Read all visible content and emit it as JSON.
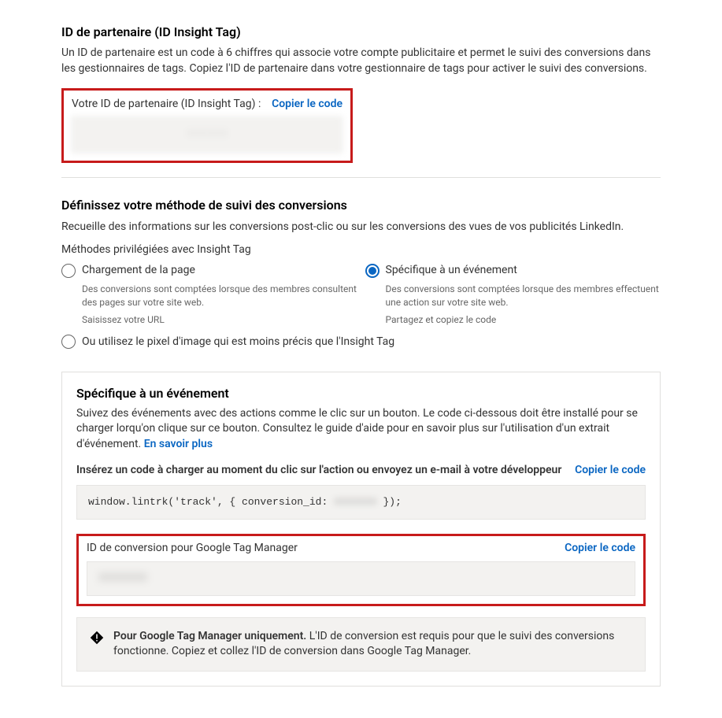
{
  "partner": {
    "title": "ID de partenaire (ID Insight Tag)",
    "desc": "Un ID de partenaire est un code à 6 chiffres qui associe votre compte publicitaire et permet le suivi des conversions dans les gestionnaires de tags. Copiez l'ID de partenaire dans votre gestionnaire de tags pour activer le suivi des conversions.",
    "label": "Votre ID de partenaire (ID Insight Tag) :",
    "copy": "Copier le code",
    "value": "XXXXXX"
  },
  "method": {
    "title": "Définissez votre méthode de suivi des conversions",
    "desc": "Recueille des informations sur les conversions post-clic ou sur les conversions des vues de vos publicités LinkedIn.",
    "preferred_label": "Méthodes privilégiées avec Insight Tag",
    "options": {
      "page": {
        "label": "Chargement de la page",
        "desc": "Des conversions sont comptées lorsque des membres consultent des pages sur votre site web.",
        "instr": "Saisissez votre URL"
      },
      "event": {
        "label": "Spécifique à un événement",
        "desc": "Des conversions sont comptées lorsque des membres effectuent une action sur votre site web.",
        "instr": "Partagez et copiez le code"
      }
    },
    "pixel_label": "Ou utilisez le pixel d'image qui est moins précis que l'Insight Tag"
  },
  "event_panel": {
    "title": "Spécifique à un événement",
    "desc": "Suivez des événements avec des actions comme le clic sur un bouton. Le code ci-dessous doit être installé pour se charger lorqu'on clique sur ce bouton. Consultez le guide d'aide pour en savoir plus sur l'utilisation d'un extrait d'événement. ",
    "learn_more": "En savoir plus",
    "insert_label": "Insérez un code à charger au moment du clic sur l'action ou envoyez un e-mail à votre développeur",
    "copy": "Copier le code",
    "code_pre": "window.lintrk('track', { conversion_id: ",
    "code_hidden": "XXXXXXX",
    "code_post": " });",
    "gtm_label": "ID de conversion pour Google Tag Manager",
    "gtm_copy": "Copier le code",
    "gtm_value": "XXXXXXX",
    "warning_bold": "Pour Google Tag Manager uniquement.",
    "warning_rest": " L'ID de conversion est requis pour que le suivi des conversions fonctionne. Copiez et collez l'ID de conversion dans Google Tag Manager."
  }
}
